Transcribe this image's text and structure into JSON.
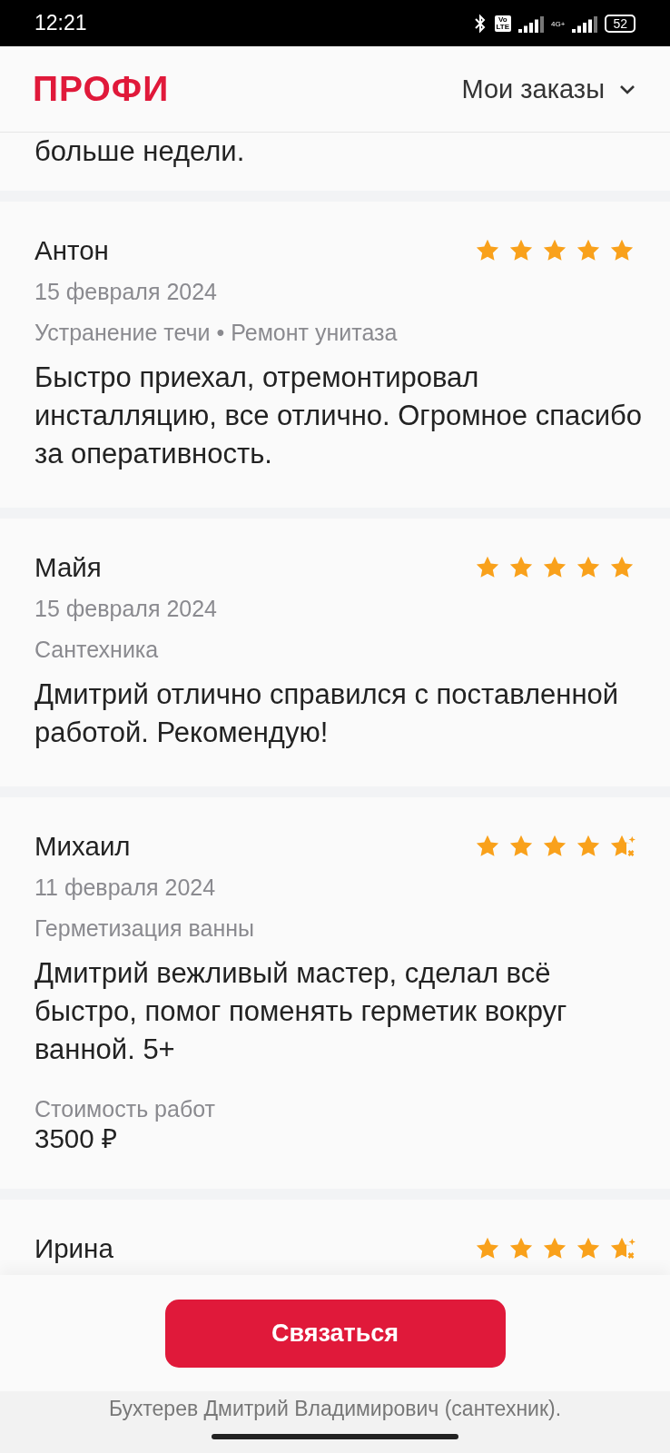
{
  "status_bar": {
    "time": "12:21",
    "volte": [
      "Vo",
      "LTE"
    ],
    "network": "4G+",
    "battery": "52"
  },
  "header": {
    "logo": "ПРОФИ",
    "menu": "Мои заказы"
  },
  "cut_text": "больше недели.",
  "reviews": [
    {
      "name": "Антон",
      "date": "15 февраля 2024",
      "tags": "Устранение течи • Ремонт унитаза",
      "text": "Быстро приехал, отремонтировал инсталляцию, все отлично. Огромное спасибо за оперативность.",
      "stars": 5,
      "sparkle": false
    },
    {
      "name": "Майя",
      "date": "15 февраля 2024",
      "tags": "Сантехника",
      "text": "Дмитрий отлично справился с поставленной работой. Рекомендую!",
      "stars": 5,
      "sparkle": false
    },
    {
      "name": "Михаил",
      "date": "11 февраля 2024",
      "tags": "Герметизация ванны",
      "text": "Дмитрий вежливый мастер, сделал всё быстро, помог поменять герметик вокруг ванной. 5+",
      "cost_label": "Стоимость работ",
      "cost": "3500 ₽",
      "stars": 5,
      "sparkle": true
    },
    {
      "name": "Ирина",
      "stars": 5,
      "sparkle": true
    }
  ],
  "contact_button": "Связаться",
  "footer": "Бухтерев Дмитрий Владимирович (сантехник)."
}
